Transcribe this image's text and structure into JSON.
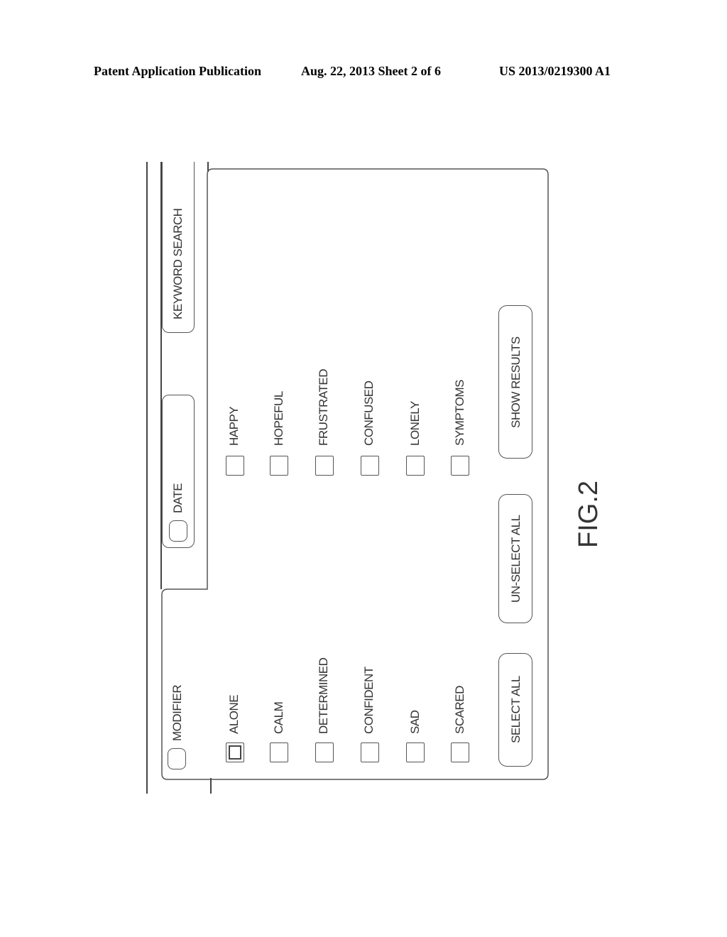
{
  "header": {
    "left": "Patent Application Publication",
    "center": "Aug. 22, 2013  Sheet 2 of 6",
    "right": "US 2013/0219300 A1"
  },
  "tabs": {
    "keyword_search": "KEYWORD SEARCH",
    "date": "DATE",
    "modifier": "MODIFIER"
  },
  "checkboxes_left": [
    {
      "label": "ALONE",
      "checked": true
    },
    {
      "label": "CALM",
      "checked": false
    },
    {
      "label": "DETERMINED",
      "checked": false
    },
    {
      "label": "CONFIDENT",
      "checked": false
    },
    {
      "label": "SAD",
      "checked": false
    },
    {
      "label": "SCARED",
      "checked": false
    }
  ],
  "checkboxes_right": [
    {
      "label": "HAPPY",
      "checked": false
    },
    {
      "label": "HOPEFUL",
      "checked": false
    },
    {
      "label": "FRUSTRATED",
      "checked": false
    },
    {
      "label": "CONFUSED",
      "checked": false
    },
    {
      "label": "LONELY",
      "checked": false
    },
    {
      "label": "SYMPTOMS",
      "checked": false
    }
  ],
  "buttons": {
    "select_all": "SELECT ALL",
    "unselect_all": "UN-SELECT ALL",
    "show_results": "SHOW RESULTS"
  },
  "figure_label": "FIG.2"
}
